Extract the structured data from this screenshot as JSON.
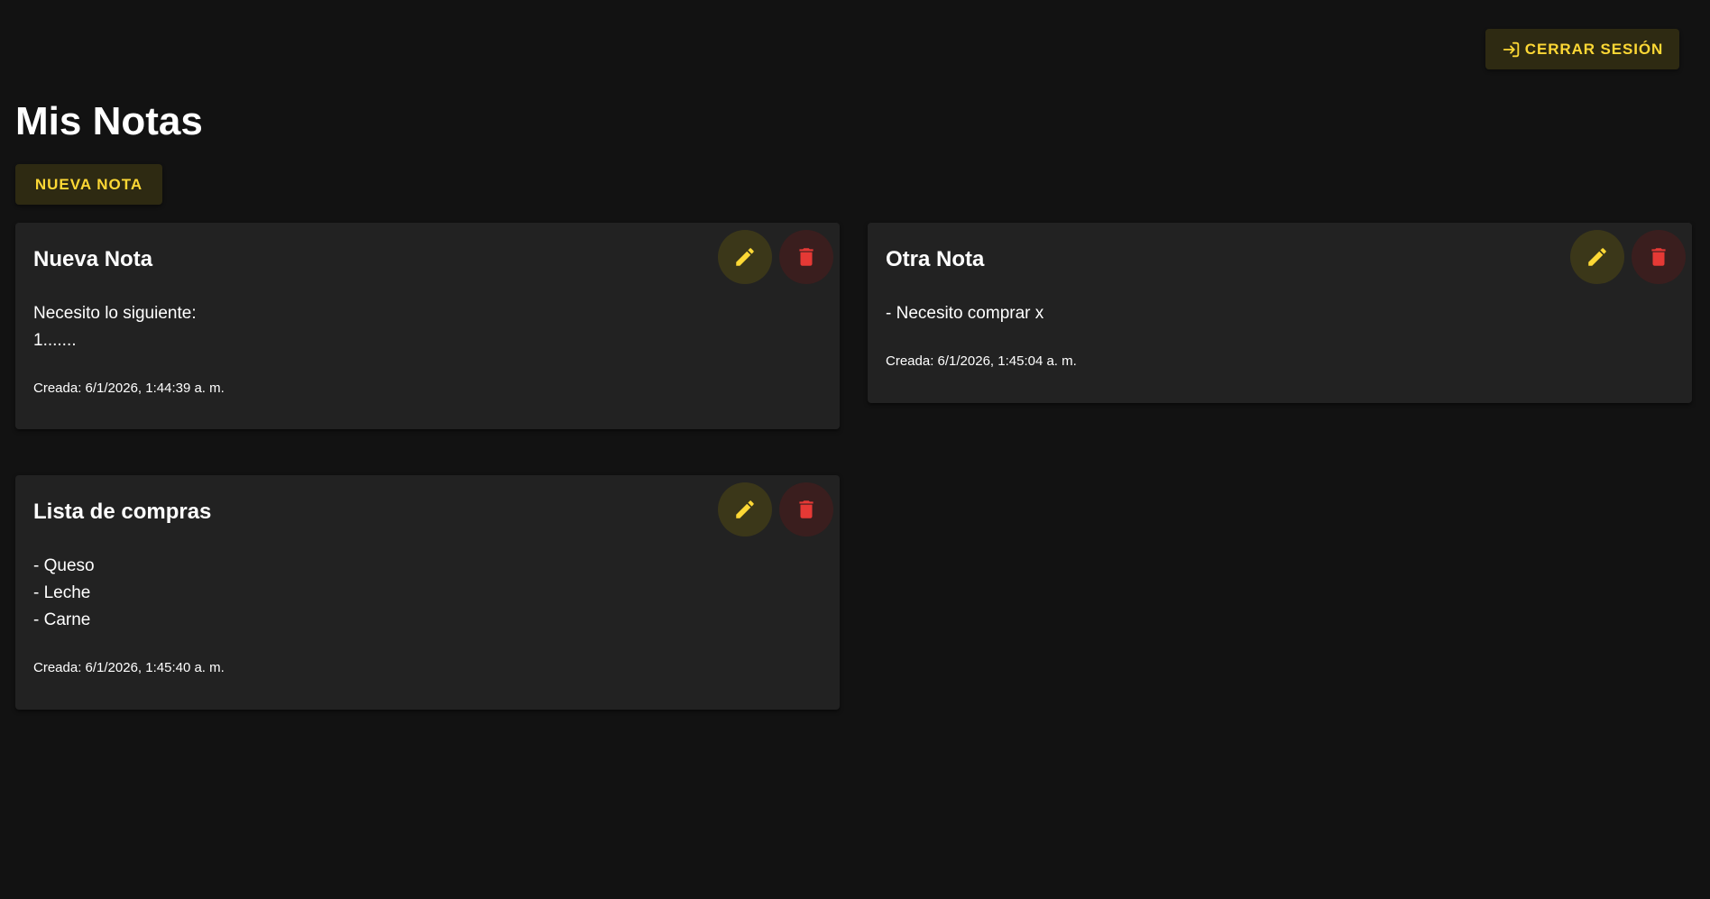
{
  "header": {
    "logout_label": "CERRAR SESIÓN",
    "logout_icon": "logout-icon"
  },
  "main": {
    "title": "Mis Notas",
    "new_note_label": "NUEVA NOTA"
  },
  "colors": {
    "accent": "#fdd835",
    "danger": "#e53935",
    "background": "#121212",
    "card": "#222222"
  },
  "notes": [
    {
      "title": "Nueva Nota",
      "body": [
        "Necesito lo siguiente:",
        "1......."
      ],
      "created": "Creada: 6/1/2026, 1:44:39 a. m."
    },
    {
      "title": "Otra Nota",
      "body": [
        "- Necesito comprar x"
      ],
      "created": "Creada: 6/1/2026, 1:45:04 a. m."
    },
    {
      "title": "Lista de compras",
      "body": [
        "- Queso",
        "- Leche",
        "- Carne"
      ],
      "created": "Creada: 6/1/2026, 1:45:40 a. m."
    }
  ]
}
